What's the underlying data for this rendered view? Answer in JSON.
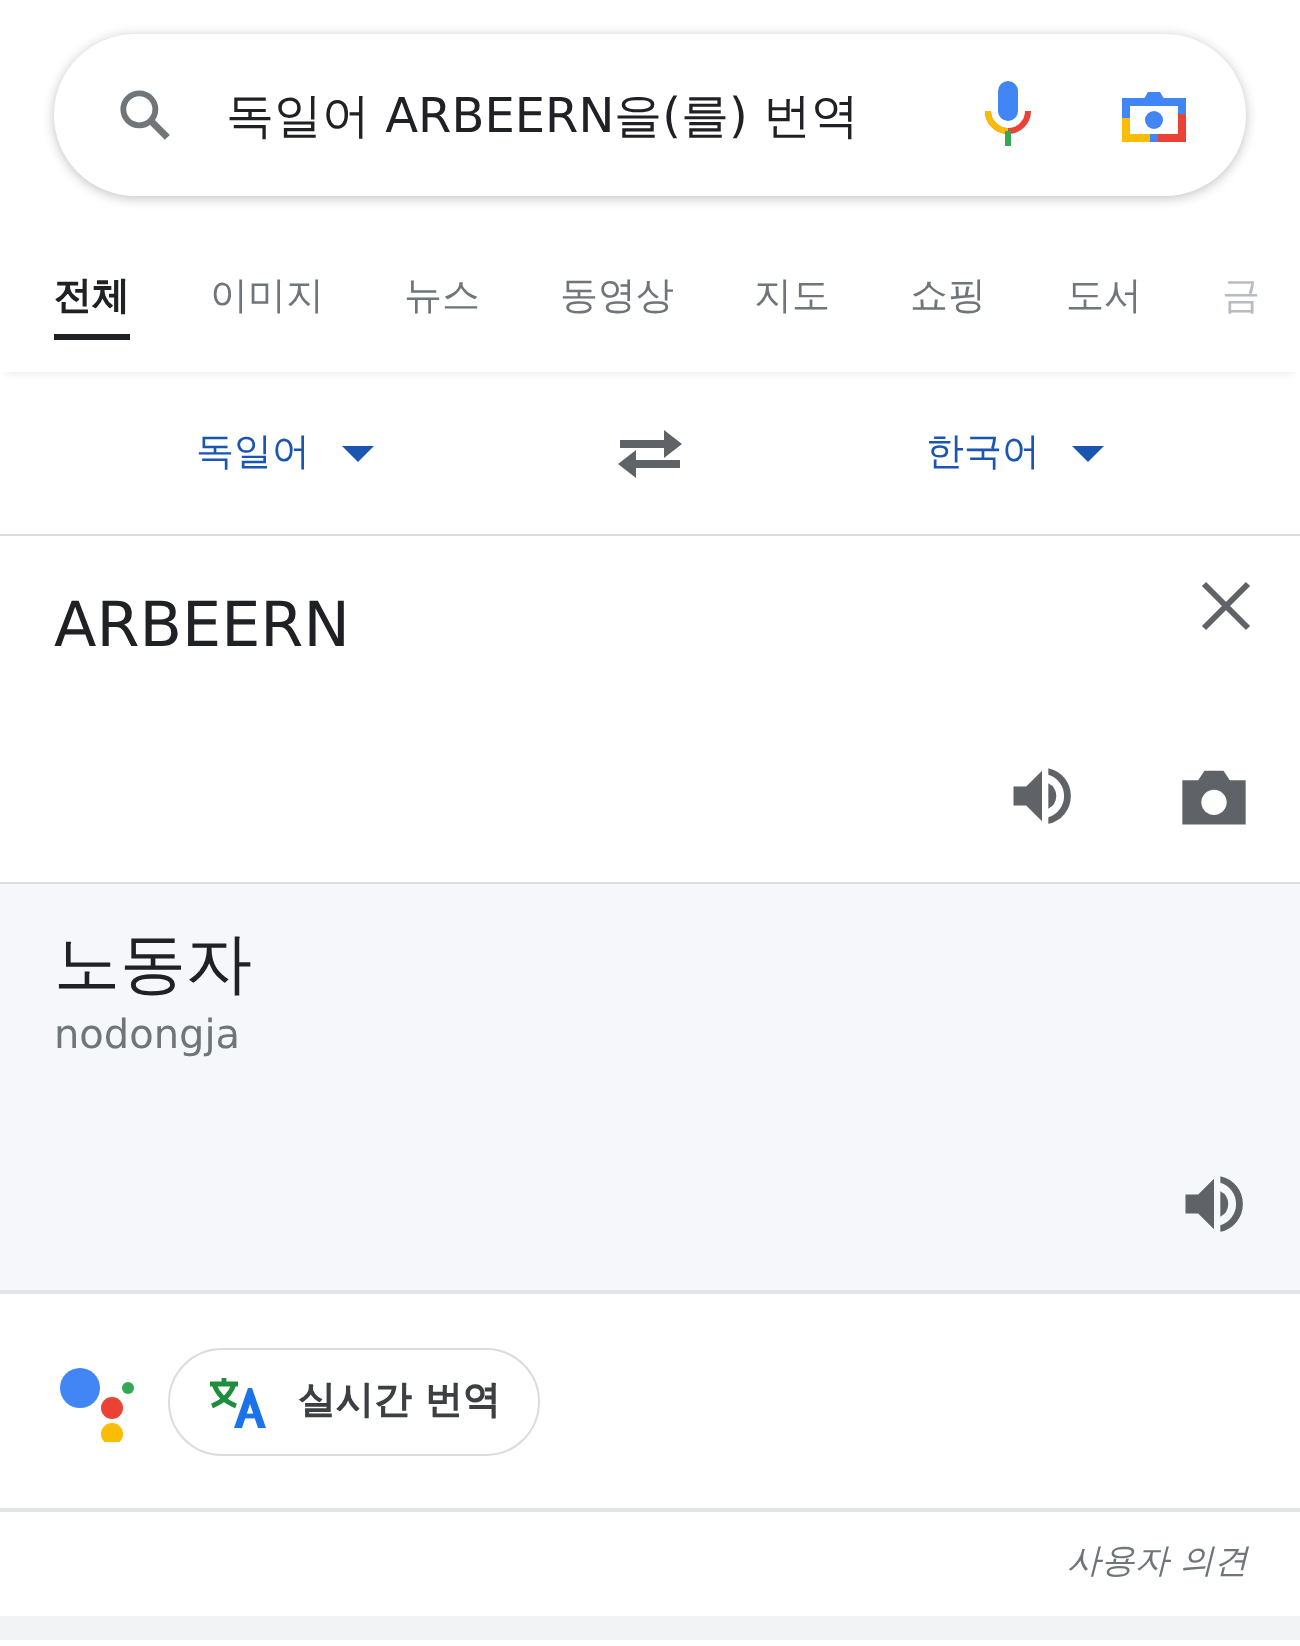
{
  "search": {
    "query": "독일어 ARBEERN을(를) 번역"
  },
  "tabs": [
    {
      "label": "전체",
      "selected": true
    },
    {
      "label": "이미지",
      "selected": false
    },
    {
      "label": "뉴스",
      "selected": false
    },
    {
      "label": "동영상",
      "selected": false
    },
    {
      "label": "지도",
      "selected": false
    },
    {
      "label": "쇼핑",
      "selected": false
    },
    {
      "label": "도서",
      "selected": false
    },
    {
      "label": "금",
      "selected": false
    }
  ],
  "translator": {
    "source_language": "독일어",
    "target_language": "한국어",
    "source_text": "ARBEERN",
    "translation": "노동자",
    "romanization": "nodongja"
  },
  "live_translate_button": "실시간 번역",
  "feedback_link": "사용자 의견"
}
